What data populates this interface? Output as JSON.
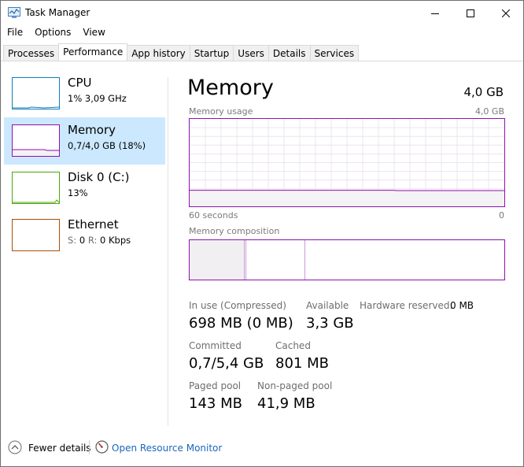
{
  "window": {
    "title": "Task Manager",
    "icon": "task-manager-icon",
    "controls": [
      "minimize-icon",
      "maximize-icon",
      "close-icon"
    ]
  },
  "menu": [
    "File",
    "Options",
    "View"
  ],
  "tabs": [
    {
      "label": "Processes",
      "active": false
    },
    {
      "label": "Performance",
      "active": true
    },
    {
      "label": "App history",
      "active": false
    },
    {
      "label": "Startup",
      "active": false
    },
    {
      "label": "Users",
      "active": false
    },
    {
      "label": "Details",
      "active": false
    },
    {
      "label": "Services",
      "active": false
    }
  ],
  "sidebar": [
    {
      "name": "CPU",
      "detail": "1% 3,09 GHz",
      "color": "#117dbb",
      "selected": false
    },
    {
      "name": "Memory",
      "detail": "0,7/4,0 GB (18%)",
      "color": "#8b12ae",
      "selected": true
    },
    {
      "name": "Disk 0 (C:)",
      "detail": "13%",
      "color": "#4da60c",
      "selected": false
    },
    {
      "name": "Ethernet",
      "detail_send_label": "S:",
      "detail_send": "0",
      "detail_recv_label": "R:",
      "detail_recv": "0 Kbps",
      "color": "#a74f01",
      "selected": false
    }
  ],
  "main": {
    "title": "Memory",
    "total": "4,0 GB",
    "usage_label": "Memory usage",
    "usage_max": "4,0 GB",
    "time_label": "60 seconds",
    "time_end": "0",
    "composition_label": "Memory composition",
    "usage_fraction": 0.18,
    "stats": {
      "in_use_label": "In use (Compressed)",
      "in_use_value": "698 MB (0 MB)",
      "available_label": "Available",
      "available_value": "3,3 GB",
      "hw_reserved_label": "Hardware reserved:",
      "hw_reserved_value": "0 MB",
      "committed_label": "Committed",
      "committed_value": "0,7/5,4 GB",
      "cached_label": "Cached",
      "cached_value": "801 MB",
      "paged_label": "Paged pool",
      "paged_value": "143 MB",
      "nonpaged_label": "Non-paged pool",
      "nonpaged_value": "41,9 MB"
    }
  },
  "footer": {
    "fewer_details": "Fewer details",
    "open_resource_monitor": "Open Resource Monitor"
  },
  "colors": {
    "memory_accent": "#8b12ae",
    "selection": "#cce8ff",
    "link": "#1a66c0"
  }
}
